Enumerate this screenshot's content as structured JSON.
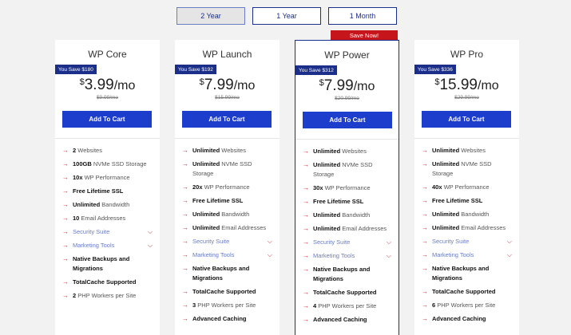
{
  "terms": [
    {
      "label": "2 Year",
      "active": true
    },
    {
      "label": "1 Year",
      "active": false
    },
    {
      "label": "1 Month",
      "active": false
    }
  ],
  "save_now": "Save Now!",
  "colors": {
    "brand": "#1b2f8a",
    "button": "#1d3ecc",
    "accent": "#c6161c",
    "arrow": "#d42a3a"
  },
  "plans": [
    {
      "name": "WP Core",
      "you_save": "You Save $180",
      "currency": "$",
      "price": "3.99",
      "per": "/mo",
      "old_price": "$9.99/mo",
      "cart": "Add To Cart",
      "features": [
        {
          "b": "2",
          "t": " Websites"
        },
        {
          "b": "100GB",
          "t": " NVMe SSD Storage"
        },
        {
          "b": "10x",
          "t": " WP Performance"
        },
        {
          "b": "Free Lifetime SSL",
          "t": ""
        },
        {
          "b": "Unlimited",
          "t": " Bandwidth"
        },
        {
          "b": "10",
          "t": " Email Addresses"
        },
        {
          "toggle": "Security Suite"
        },
        {
          "toggle": "Marketing Tools"
        },
        {
          "b": "Native Backups and Migrations",
          "t": ""
        },
        {
          "b": "TotalCache Supported",
          "t": ""
        },
        {
          "b": "2",
          "t": " PHP Workers per Site"
        }
      ]
    },
    {
      "name": "WP Launch",
      "you_save": "You Save $192",
      "currency": "$",
      "price": "7.99",
      "per": "/mo",
      "old_price": "$15.99/mo",
      "cart": "Add To Cart",
      "features": [
        {
          "b": "Unlimited",
          "t": " Websites"
        },
        {
          "b": "Unlimited",
          "t": " NVMe SSD Storage"
        },
        {
          "b": "20x",
          "t": " WP Performance"
        },
        {
          "b": "Free Lifetime SSL",
          "t": ""
        },
        {
          "b": "Unlimited",
          "t": " Bandwidth"
        },
        {
          "b": "Unlimited",
          "t": " Email Addresses"
        },
        {
          "toggle": "Security Suite"
        },
        {
          "toggle": "Marketing Tools"
        },
        {
          "b": "Native Backups and Migrations",
          "t": ""
        },
        {
          "b": "TotalCache Supported",
          "t": ""
        },
        {
          "b": "3",
          "t": " PHP Workers per Site"
        },
        {
          "b": "Advanced Caching",
          "t": ""
        }
      ]
    },
    {
      "name": "WP Power",
      "you_save": "You Save $312",
      "currency": "$",
      "price": "7.99",
      "per": "/mo",
      "old_price": "$20.99/mo",
      "cart": "Add To Cart",
      "features": [
        {
          "b": "Unlimited",
          "t": " Websites"
        },
        {
          "b": "Unlimited",
          "t": " NVMe SSD Storage"
        },
        {
          "b": "30x",
          "t": " WP Performance"
        },
        {
          "b": "Free Lifetime SSL",
          "t": ""
        },
        {
          "b": "Unlimited",
          "t": " Bandwidth"
        },
        {
          "b": "Unlimited",
          "t": " Email Addresses"
        },
        {
          "toggle": "Security Suite"
        },
        {
          "toggle": "Marketing Tools"
        },
        {
          "b": "Native Backups and Migrations",
          "t": ""
        },
        {
          "b": "TotalCache Supported",
          "t": ""
        },
        {
          "b": "4",
          "t": " PHP Workers per Site"
        },
        {
          "b": "Advanced Caching",
          "t": ""
        }
      ]
    },
    {
      "name": "WP Pro",
      "you_save": "You Save $336",
      "currency": "$",
      "price": "15.99",
      "per": "/mo",
      "old_price": "$29.99/mo",
      "cart": "Add To Cart",
      "features": [
        {
          "b": "Unlimited",
          "t": " Websites"
        },
        {
          "b": "Unlimited",
          "t": " NVMe SSD Storage"
        },
        {
          "b": "40x",
          "t": " WP Performance"
        },
        {
          "b": "Free Lifetime SSL",
          "t": ""
        },
        {
          "b": "Unlimited",
          "t": " Bandwidth"
        },
        {
          "b": "Unlimited",
          "t": " Email Addresses"
        },
        {
          "toggle": "Security Suite"
        },
        {
          "toggle": "Marketing Tools"
        },
        {
          "b": "Native Backups and Migrations",
          "t": ""
        },
        {
          "b": "TotalCache Supported",
          "t": ""
        },
        {
          "b": "6",
          "t": " PHP Workers per Site"
        },
        {
          "b": "Advanced Caching",
          "t": ""
        }
      ]
    }
  ]
}
